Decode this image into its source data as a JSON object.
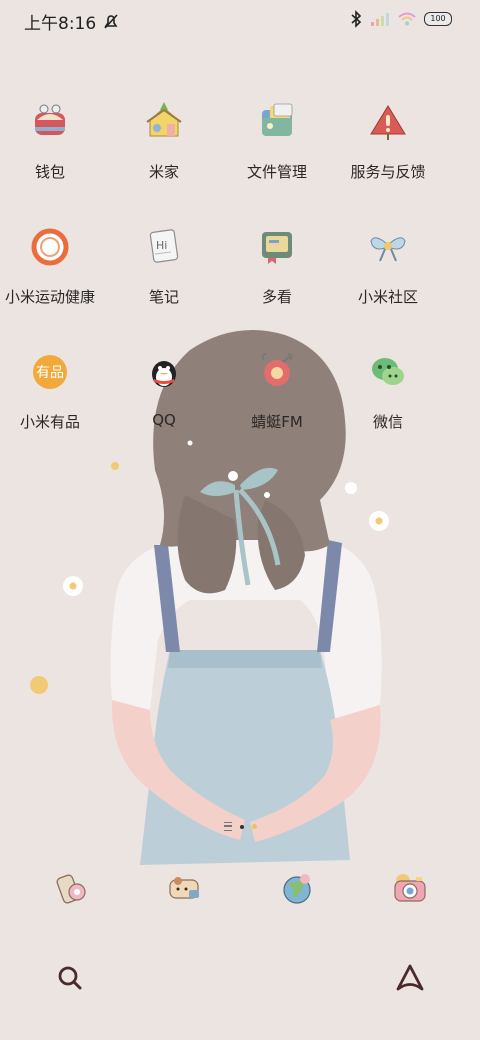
{
  "status_bar": {
    "time": "上午8:16",
    "battery": "100",
    "icons": [
      "alarm-off-icon",
      "bluetooth-icon",
      "signal-icon",
      "wifi-icon",
      "battery-icon"
    ]
  },
  "apps": [
    {
      "label": "钱包",
      "icon": "wallet-icon"
    },
    {
      "label": "米家",
      "icon": "mijia-house-icon"
    },
    {
      "label": "文件管理",
      "icon": "file-manager-icon"
    },
    {
      "label": "服务与反馈",
      "icon": "service-feedback-icon"
    },
    {
      "label": "小米运动健康",
      "icon": "mi-fitness-ring-icon"
    },
    {
      "label": "笔记",
      "icon": "notes-icon"
    },
    {
      "label": "多看",
      "icon": "duokan-reader-icon"
    },
    {
      "label": "小米社区",
      "icon": "community-bow-icon"
    },
    {
      "label": "小米有品",
      "icon": "youpin-icon",
      "icon_text": "有品"
    },
    {
      "label": "QQ",
      "icon": "qq-penguin-icon"
    },
    {
      "label": "蜻蜓FM",
      "icon": "qingting-fm-icon"
    },
    {
      "label": "微信",
      "icon": "wechat-icon"
    }
  ],
  "dock": [
    {
      "icon": "phone-icon"
    },
    {
      "icon": "messages-icon"
    },
    {
      "icon": "browser-globe-icon"
    },
    {
      "icon": "camera-icon"
    }
  ],
  "bottom_bar": {
    "left_icon": "search-icon",
    "right_icon": "assistant-icon"
  },
  "colors": {
    "background": "#ece4e1",
    "hair": "#8e8078",
    "dress": "#bcd0da",
    "strap": "#7e8aa9",
    "shirt": "#f5f0ef",
    "skin": "#f2cfc9",
    "flower_yellow": "#f2cf7a"
  }
}
